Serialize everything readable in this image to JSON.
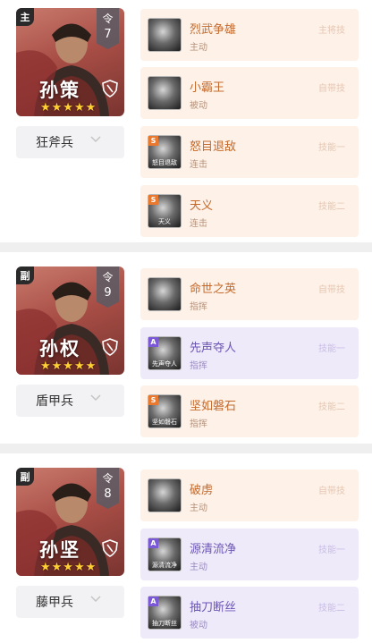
{
  "generals": [
    {
      "role": "主",
      "order_label": "令",
      "order": "7",
      "name": "孙策",
      "stars": "★★★★★",
      "troop": "狂斧兵",
      "skills": [
        {
          "name": "烈武争雄",
          "type": "主动",
          "slot": "主将技",
          "grade": "",
          "icon_text": "",
          "theme": "orange"
        },
        {
          "name": "小霸王",
          "type": "被动",
          "slot": "自带技",
          "grade": "",
          "icon_text": "",
          "theme": "orange"
        },
        {
          "name": "怒目退敌",
          "type": "连击",
          "slot": "技能一",
          "grade": "S",
          "icon_text": "怒目退敌",
          "theme": "orange"
        },
        {
          "name": "天义",
          "type": "连击",
          "slot": "技能二",
          "grade": "S",
          "icon_text": "天义",
          "theme": "orange"
        }
      ]
    },
    {
      "role": "副",
      "order_label": "令",
      "order": "9",
      "name": "孙权",
      "stars": "★★★★★",
      "troop": "盾甲兵",
      "skills": [
        {
          "name": "命世之英",
          "type": "指挥",
          "slot": "自带技",
          "grade": "",
          "icon_text": "",
          "theme": "orange"
        },
        {
          "name": "先声夺人",
          "type": "指挥",
          "slot": "技能一",
          "grade": "A",
          "icon_text": "先声夺人",
          "theme": "purple"
        },
        {
          "name": "坚如磐石",
          "type": "指挥",
          "slot": "技能二",
          "grade": "S",
          "icon_text": "坚如磐石",
          "theme": "orange"
        }
      ]
    },
    {
      "role": "副",
      "order_label": "令",
      "order": "8",
      "name": "孙坚",
      "stars": "★★★★★",
      "troop": "藤甲兵",
      "skills": [
        {
          "name": "破虏",
          "type": "主动",
          "slot": "自带技",
          "grade": "",
          "icon_text": "",
          "theme": "orange"
        },
        {
          "name": "源清流净",
          "type": "主动",
          "slot": "技能一",
          "grade": "A",
          "icon_text": "源清流净",
          "theme": "purple"
        },
        {
          "name": "抽刀断丝",
          "type": "被动",
          "slot": "技能二",
          "grade": "A",
          "icon_text": "抽刀断丝",
          "theme": "purple"
        }
      ]
    }
  ],
  "colors": {
    "skill_orange_bg": "#fdf1e8",
    "skill_purple_bg": "#efeaf9",
    "grade_s": "#e8792e",
    "grade_a": "#7b58d6",
    "star": "#ffcf33"
  }
}
